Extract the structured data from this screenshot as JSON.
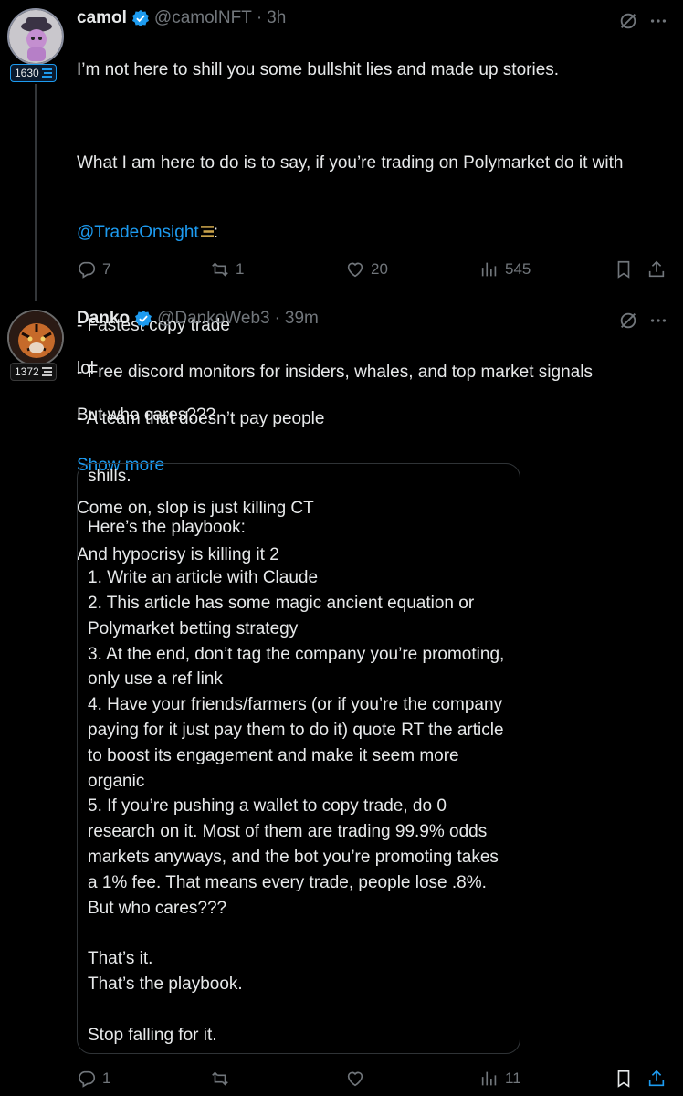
{
  "tweet1": {
    "name": "camol",
    "handle": "@camolNFT",
    "dot": "·",
    "time": "3h",
    "rank": "1630",
    "line1": "I’m not here to shill you some bullshit lies and made up stories.",
    "line2": "What I am here to do is to say, if you’re trading on Polymarket do it with",
    "mention": "@TradeOnsight",
    "mention_suffix": ":",
    "bullets": [
      "- Fastest copy trade",
      "- Free discord monitors for insiders, whales, and top market signals",
      "- A team that doesn’t pay people"
    ],
    "show_more": "Show more",
    "replies": "7",
    "reposts": "1",
    "likes": "20",
    "views": "545"
  },
  "tweet2": {
    "name": "Danko",
    "handle": "@DankoWeb3",
    "dot": "·",
    "time": "39m",
    "rank": "1372",
    "lines": [
      "lol",
      "But who cares???",
      "",
      "Come on, slop is just killing CT",
      "And hypocrisy is killing it 2"
    ],
    "quote": "shills.\n\nHere’s the playbook:\n\n1. Write an article with Claude\n2. This article has some magic ancient equation or Polymarket betting strategy\n3. At the end, don’t tag the company you’re promoting, only use a ref link\n4. Have your friends/farmers (or if you’re the company paying for it just pay them to do it) quote RT the article to boost its engagement and make it seem more organic\n5. If you’re pushing a wallet to copy trade, do 0 research on it. Most of them are trading 99.9% odds markets anyways, and the bot you’re promoting takes a 1% fee. That means every trade, people lose .8%. But who cares???\n\nThat’s it.\nThat’s the playbook.\n\nStop falling for it.",
    "replies": "1",
    "views": "11"
  },
  "colors": {
    "accent": "#1d9bf0",
    "muted": "#71767b",
    "text": "#e7e9ea",
    "background": "#000000"
  },
  "icons": [
    "verified-icon",
    "grok-icon",
    "more-icon",
    "reply-icon",
    "repost-icon",
    "like-icon",
    "views-icon",
    "bookmark-icon",
    "share-icon",
    "rank-icon"
  ]
}
